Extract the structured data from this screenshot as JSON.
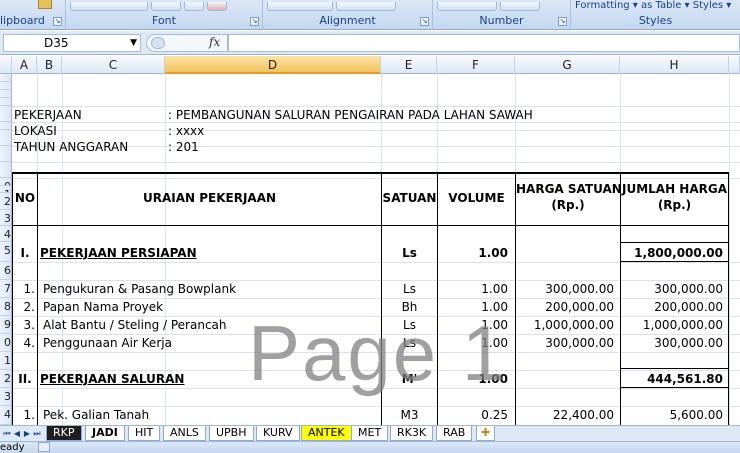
{
  "ribbon": {
    "groups": [
      {
        "label": "lipboard"
      },
      {
        "label": "Font"
      },
      {
        "label": "Alignment"
      },
      {
        "label": "Number"
      },
      {
        "label": "Styles",
        "top_items": "Formatting ▾ as Table ▾ Styles ▾"
      }
    ]
  },
  "formula_bar": {
    "name_box": "D35",
    "fx": "fx",
    "content": ""
  },
  "columns": [
    "A",
    "B",
    "C",
    "D",
    "E",
    "F",
    "G",
    "H"
  ],
  "rows": [
    "",
    "",
    "",
    "",
    "",
    "",
    "",
    "",
    "",
    "0",
    "1",
    "2",
    "3",
    "4",
    "5",
    "6",
    "7",
    "8",
    "9",
    "0",
    "1",
    "2",
    "3",
    "4"
  ],
  "project": {
    "pekerjaan_label": "PEKERJAAN",
    "pekerjaan_value": ":  PEMBANGUNAN SALURAN PENGAIRAN PADA LAHAN SAWAH",
    "lokasi_label": "LOKASI",
    "lokasi_value": ":  xxxx",
    "tahun_label": "TAHUN ANGGARAN",
    "tahun_value": ":  201"
  },
  "table_header": {
    "no": "NO",
    "uraian": "URAIAN PEKERJAAN",
    "satuan": "SATUAN",
    "volume": "VOLUME",
    "harga_satuan": "HARGA SATUAN",
    "harga_satuan_unit": "(Rp.)",
    "jumlah_harga": "JUMLAH HARGA",
    "jumlah_harga_unit": "(Rp.)"
  },
  "sections": [
    {
      "no": "I.",
      "title": "PEKERJAAN PERSIAPAN",
      "satuan": "Ls",
      "volume": "1.00",
      "jumlah": "1,800,000.00"
    },
    {
      "no": "II.",
      "title": "PEKERJAAN SALURAN",
      "satuan": "M'",
      "volume": "1.00",
      "jumlah": "444,561.80"
    }
  ],
  "items": [
    {
      "no": "1.",
      "uraian": "Pengukuran & Pasang Bowplank",
      "satuan": "Ls",
      "volume": "1.00",
      "harga": "300,000.00",
      "jumlah": "300,000.00"
    },
    {
      "no": "2.",
      "uraian": "Papan Nama Proyek",
      "satuan": "Bh",
      "volume": "1.00",
      "harga": "200,000.00",
      "jumlah": "200,000.00"
    },
    {
      "no": "3.",
      "uraian": "Alat Bantu / Steling / Perancah",
      "satuan": "Ls",
      "volume": "1.00",
      "harga": "1,000,000.00",
      "jumlah": "1,000,000.00"
    },
    {
      "no": "4.",
      "uraian": "Penggunaan Air Kerja",
      "satuan": "Ls",
      "volume": "1.00",
      "harga": "300,000.00",
      "jumlah": "300,000.00"
    },
    {
      "no": "1.",
      "uraian": "Pek. Galian Tanah",
      "satuan": "M3",
      "volume": "0.25",
      "harga": "22,400.00",
      "jumlah": "5,600.00"
    }
  ],
  "watermark": "Page 1",
  "sheet_tabs": [
    "RKP",
    "JADI",
    "HIT",
    "ANLS",
    "UPBH",
    "KURV",
    "ANTEK",
    "MET",
    "RK3K",
    "RAB"
  ],
  "status": "eady"
}
